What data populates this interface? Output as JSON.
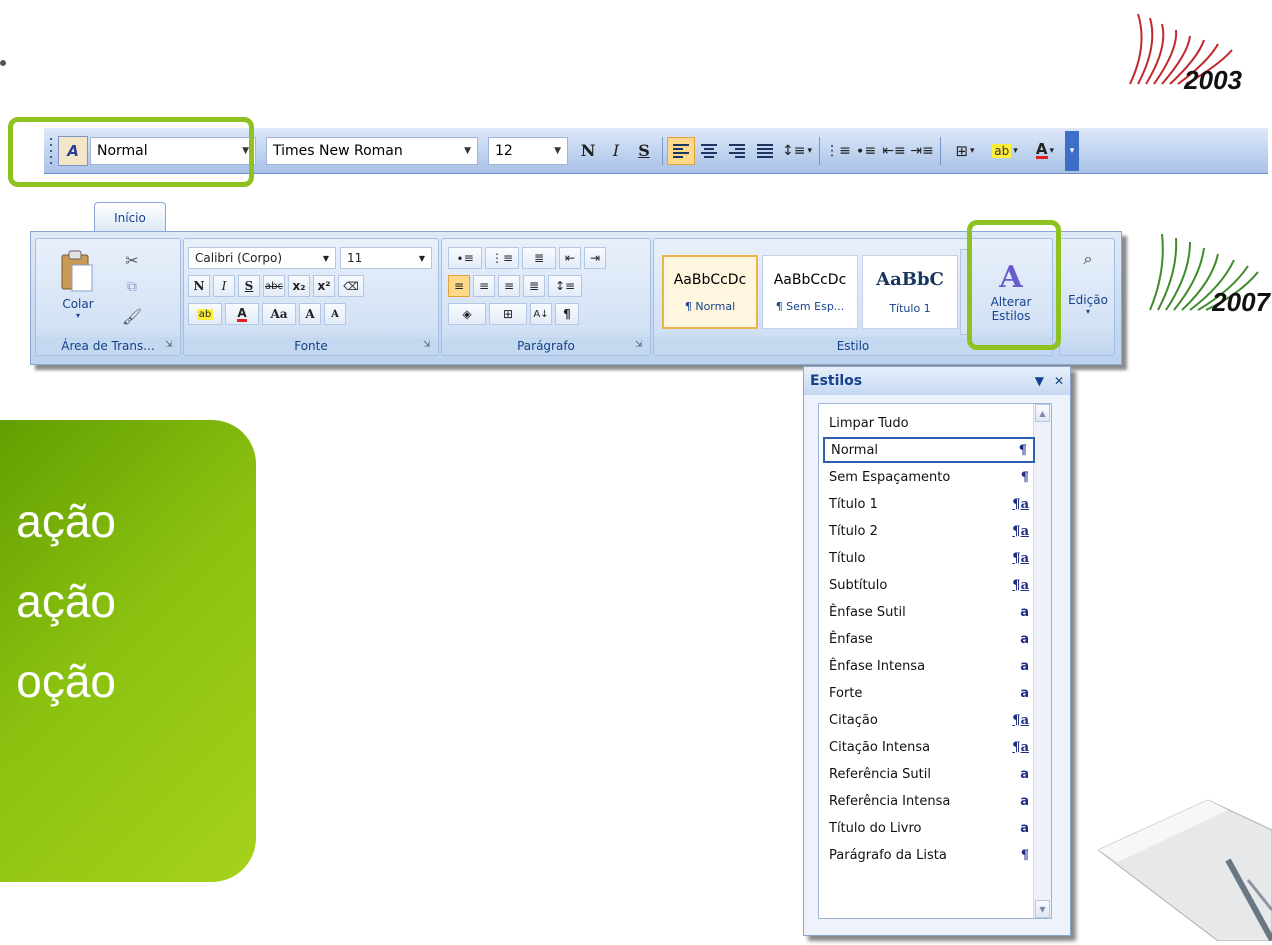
{
  "toolbar2003": {
    "style_value": "Normal",
    "font_value": "Times New Roman",
    "size_value": "12",
    "bold": "N",
    "italic": "I",
    "underline": "S"
  },
  "ribbon": {
    "tab_label": "Início",
    "clipboard": {
      "paste_label": "Colar",
      "group_label": "Área de Trans..."
    },
    "font": {
      "font_value": "Calibri (Corpo)",
      "size_value": "11",
      "bold": "N",
      "italic": "I",
      "underline": "S",
      "strike": "abc",
      "sub": "x₂",
      "sup": "x²",
      "change_case": "Aa",
      "grow": "A",
      "shrink": "A",
      "group_label": "Fonte"
    },
    "paragraph": {
      "pilcrow": "¶",
      "group_label": "Parágrafo"
    },
    "styles": {
      "items": [
        {
          "sample": "AaBbCcDc",
          "name": "¶ Normal"
        },
        {
          "sample": "AaBbCcDc",
          "name": "¶ Sem Esp..."
        },
        {
          "sample": "AaBbC",
          "name": "Título 1"
        }
      ],
      "change_styles_line1": "Alterar",
      "change_styles_line2": "Estilos",
      "group_label": "Estilo"
    },
    "editing": {
      "label": "Edição"
    }
  },
  "styles_pane": {
    "title": "Estilos",
    "items": [
      {
        "label": "Limpar Tudo",
        "marker": ""
      },
      {
        "label": "Normal",
        "marker": "¶"
      },
      {
        "label": "Sem Espaçamento",
        "marker": "¶"
      },
      {
        "label": "Título 1",
        "marker": "¶a"
      },
      {
        "label": "Título 2",
        "marker": "¶a"
      },
      {
        "label": "Título",
        "marker": "¶a"
      },
      {
        "label": "Subtítulo",
        "marker": "¶a"
      },
      {
        "label": "Ênfase Sutil",
        "marker": "a"
      },
      {
        "label": "Ênfase",
        "marker": "a"
      },
      {
        "label": "Ênfase Intensa",
        "marker": "a"
      },
      {
        "label": "Forte",
        "marker": "a"
      },
      {
        "label": "Citação",
        "marker": "¶a"
      },
      {
        "label": "Citação Intensa",
        "marker": "¶a"
      },
      {
        "label": "Referência Sutil",
        "marker": "a"
      },
      {
        "label": "Referência Intensa",
        "marker": "a"
      },
      {
        "label": "Título do Livro",
        "marker": "a"
      },
      {
        "label": "Parágrafo da Lista",
        "marker": "¶"
      }
    ]
  },
  "green_box": {
    "lines": [
      "ação",
      "ação",
      "oção"
    ]
  },
  "logos": {
    "year_2003": "2003",
    "year_2007": "2007"
  },
  "colors": {
    "highlight": "#8dc21f",
    "green_dark": "#5e9a00",
    "green_light": "#a6d21c"
  }
}
